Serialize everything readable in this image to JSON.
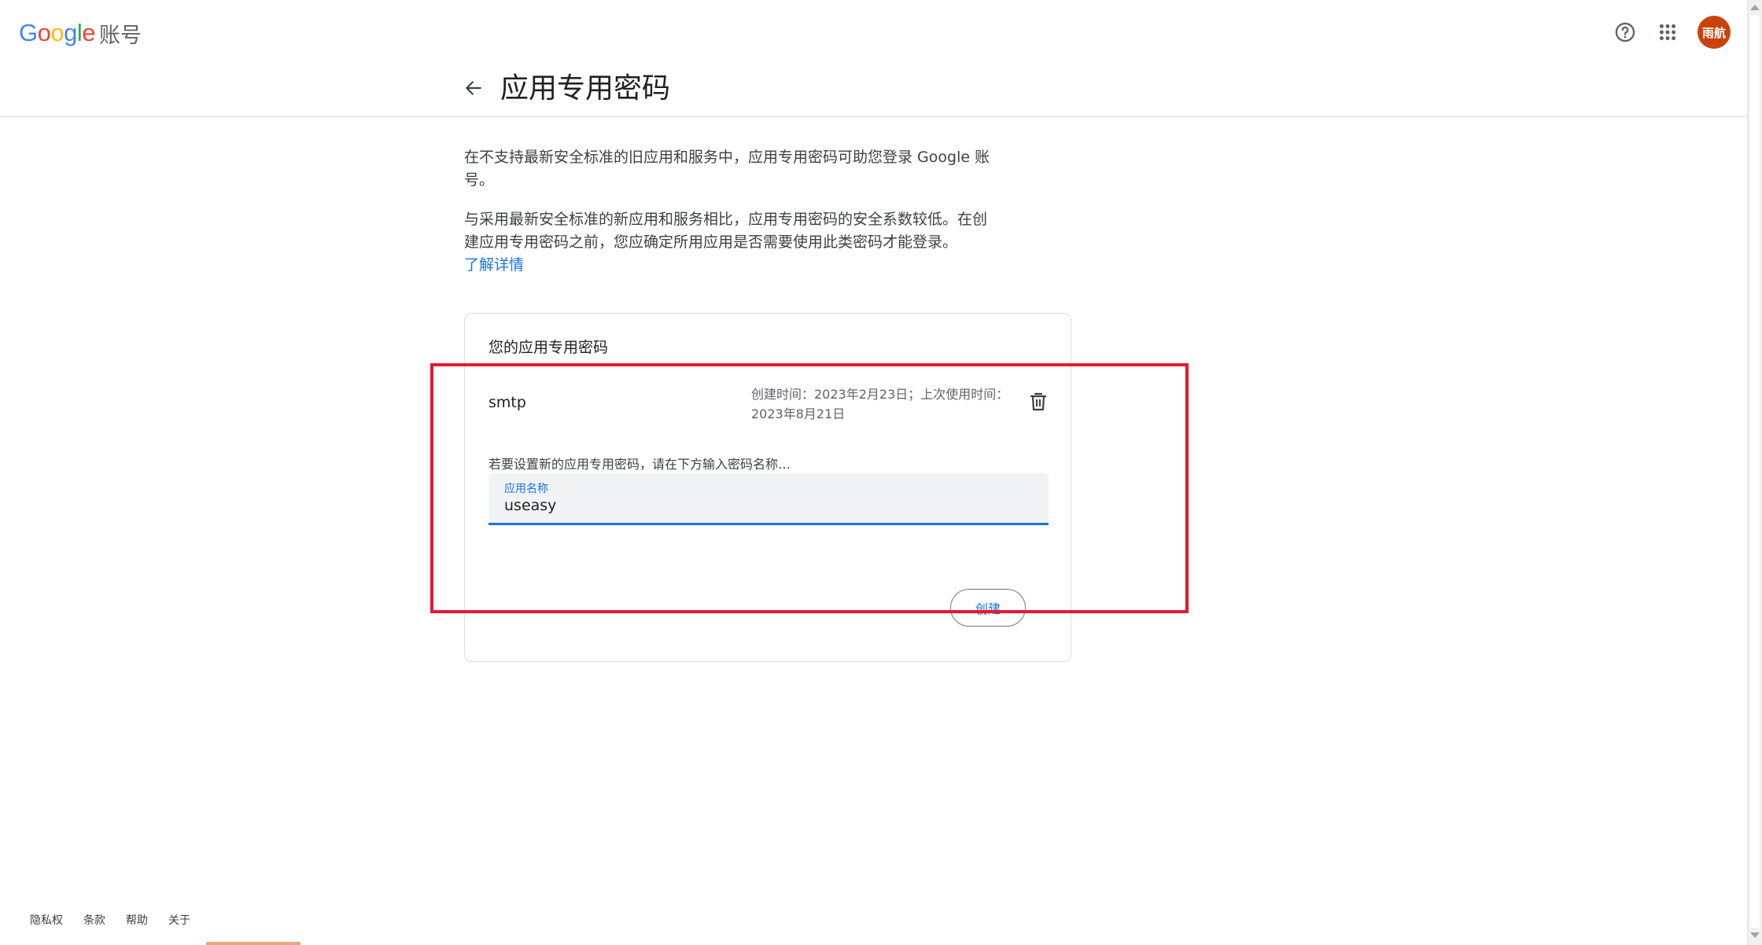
{
  "header": {
    "logo_letters": [
      "G",
      "o",
      "o",
      "g",
      "l",
      "e"
    ],
    "logo_colors": [
      "#4285F4",
      "#EA4335",
      "#FBBC05",
      "#4285F4",
      "#34A853",
      "#EA4335"
    ],
    "product": "账号",
    "help_icon": "help-circle-icon",
    "apps_icon": "apps-grid-icon",
    "avatar_text": "雨航",
    "avatar_color": "#c9430b"
  },
  "title_bar": {
    "back_icon": "arrow-back-icon",
    "title": "应用专用密码"
  },
  "intro": {
    "paragraph1": "在不支持最新安全标准的旧应用和服务中，应用专用密码可助您登录 Google 账号。",
    "paragraph2": "与采用最新安全标准的新应用和服务相比，应用专用密码的安全系数较低。在创建应用专用密码之前，您应确定所用应用是否需要使用此类密码才能登录。",
    "learn_more": "了解详情"
  },
  "card": {
    "title": "您的应用专用密码",
    "passwords": [
      {
        "name": "smtp",
        "meta": "创建时间：2023年2月23日；上次使用时间：2023年8月21日",
        "delete_icon": "trash-icon"
      }
    ],
    "new_hint": "若要设置新的应用专用密码，请在下方输入密码名称…",
    "field_label": "应用名称",
    "field_value": "useasy",
    "create_label": "创建"
  },
  "colors": {
    "accent": "#1a73e8",
    "highlight": "#e8192c"
  },
  "footer": {
    "links": [
      "隐私权",
      "条款",
      "帮助",
      "关于"
    ]
  }
}
